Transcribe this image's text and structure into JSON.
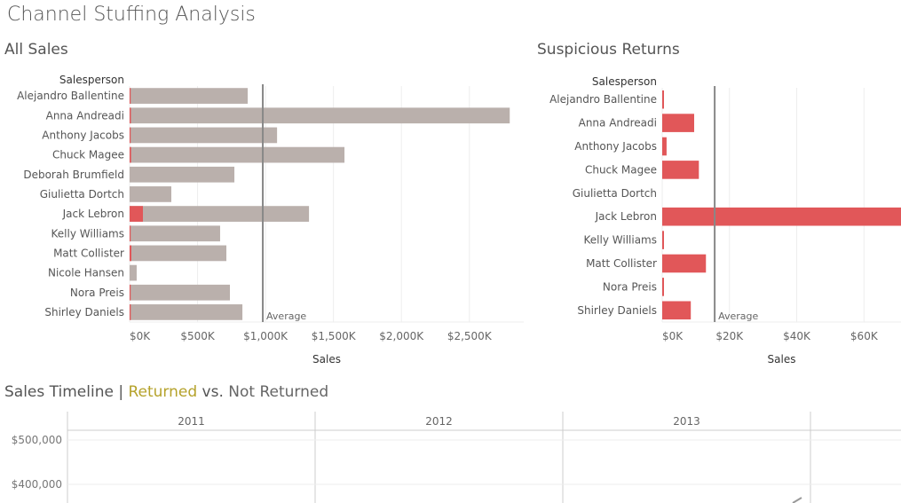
{
  "dashboard_title": "Channel Stuffing Analysis",
  "colors": {
    "all_sales_bar": "#bab0ac",
    "returned": "#e15759",
    "returned_title": "#b5a22b",
    "reference_line": "#888888",
    "grid": "#eeeeee"
  },
  "chart_data": [
    {
      "type": "bar",
      "orientation": "horizontal",
      "title": "All Sales",
      "row_header": "Salesperson",
      "xlabel": "Sales",
      "xlim": [
        0,
        2900
      ],
      "x_unit": "K$",
      "x_ticks": [
        "$0K",
        "$500K",
        "$1,000K",
        "$1,500K",
        "$2,000K",
        "$2,500K"
      ],
      "x_tick_values": [
        0,
        500,
        1000,
        1500,
        2000,
        2500
      ],
      "grid": true,
      "categories": [
        "Alejandro Ballentine",
        "Anna Andreadi",
        "Anthony Jacobs",
        "Chuck Magee",
        "Deborah Brumfield",
        "Giulietta Dortch",
        "Jack Lebron",
        "Kelly Williams",
        "Matt Collister",
        "Nicole Hansen",
        "Nora Preis",
        "Shirley Daniels"
      ],
      "series": [
        {
          "values": [
            869,
            2797,
            1085,
            1581,
            771,
            307,
            1320,
            666,
            712,
            52,
            738,
            830
          ]
        },
        {
          "values": [
            0.5,
            9.5,
            1.3,
            10.9,
            0,
            0,
            98,
            0.3,
            13,
            0,
            0.5,
            8.5
          ]
        }
      ],
      "reference_line": {
        "label": "Average",
        "value": 980
      }
    },
    {
      "type": "bar",
      "orientation": "horizontal",
      "title": "Suspicious Returns",
      "row_header": "Salesperson",
      "xlabel": "Sales",
      "xlim": [
        0,
        71
      ],
      "x_unit": "K$",
      "x_ticks": [
        "$0K",
        "$20K",
        "$40K",
        "$60K"
      ],
      "x_tick_values": [
        0,
        20,
        40,
        60
      ],
      "grid": true,
      "categories": [
        "Alejandro Ballentine",
        "Anna Andreadi",
        "Anthony Jacobs",
        "Chuck Magee",
        "Giulietta Dortch",
        "Jack Lebron",
        "Kelly Williams",
        "Matt Collister",
        "Nora Preis",
        "Shirley Daniels"
      ],
      "values": [
        0.5,
        9.5,
        1.3,
        10.9,
        0,
        98,
        0.3,
        13,
        0.5,
        8.5
      ],
      "reference_line": {
        "label": "Average",
        "value": 15.6
      }
    },
    {
      "type": "line",
      "title_parts": [
        "Sales Timeline | ",
        "Returned",
        " vs. ",
        "Not Returned"
      ],
      "columns": [
        "2011",
        "2012",
        "2013",
        ""
      ],
      "y_ticks": [
        "$500,000",
        "$400,000"
      ],
      "y_tick_values": [
        500000,
        400000
      ],
      "grid": true
    }
  ]
}
